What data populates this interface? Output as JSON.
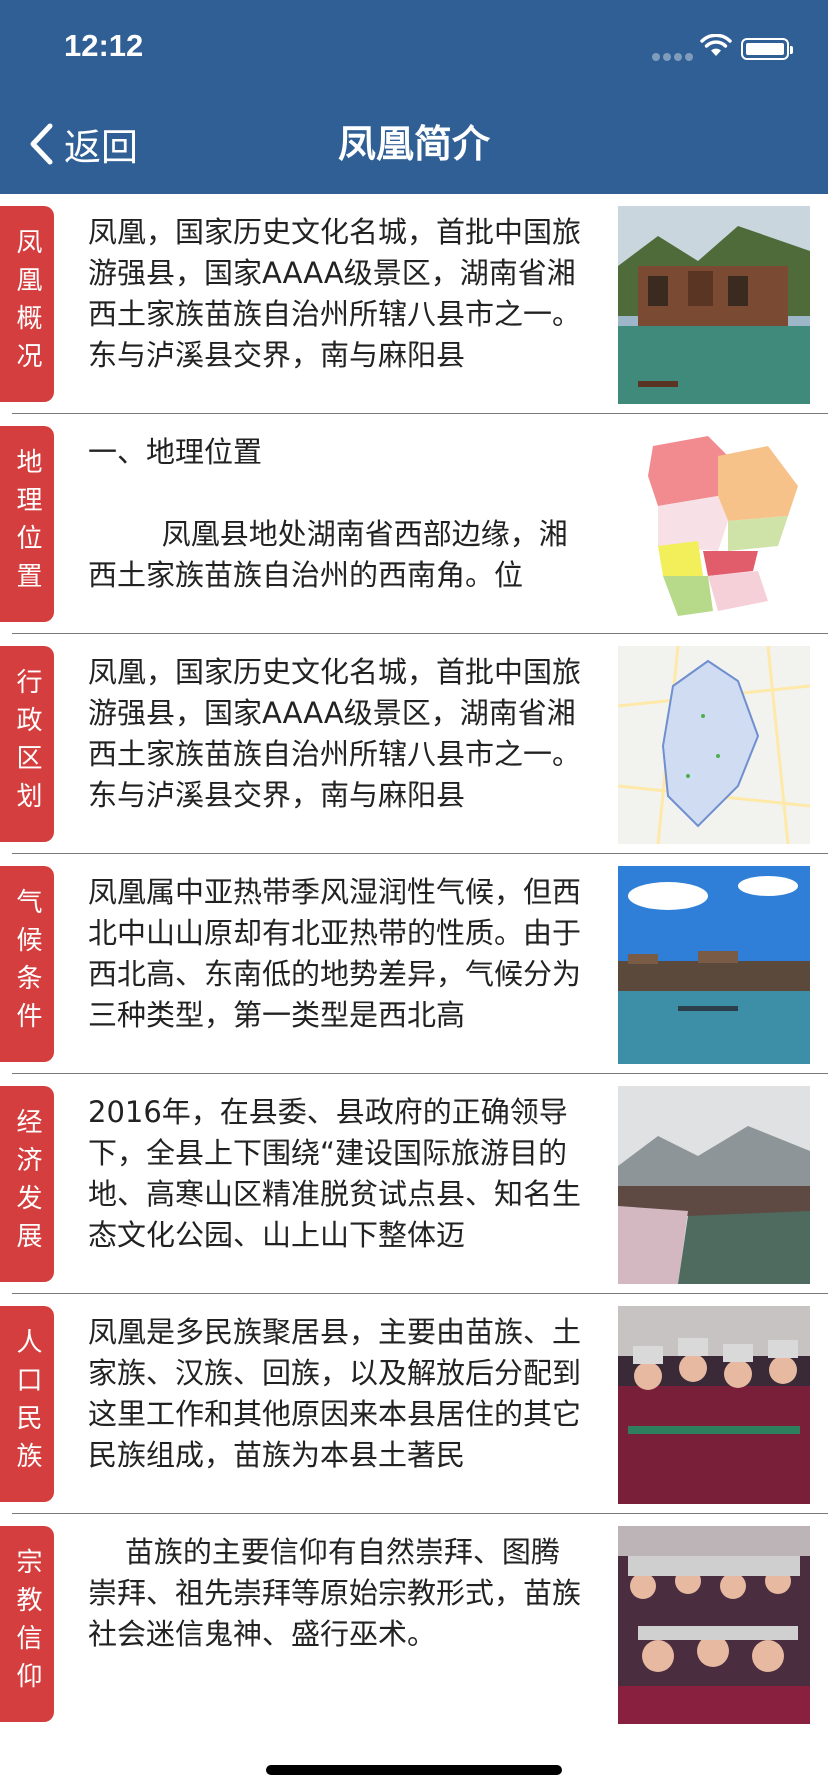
{
  "status": {
    "time": "12:12"
  },
  "nav": {
    "back_label": "返回",
    "title": "凤凰简介"
  },
  "items": [
    {
      "tag": "凤凰概况",
      "text": "凤凰，国家历史文化名城，首批中国旅游强县，国家AAAA级景区，湖南省湘西土家族苗族自治州所辖八县市之一。东与泸溪县交界，南与麻阳县"
    },
    {
      "tag": "地理位置",
      "text": "一、地理位置\n\n        凤凰县地处湖南省西部边缘，湘西土家族苗族自治州的西南角。位"
    },
    {
      "tag": "行政区划",
      "text": "凤凰，国家历史文化名城，首批中国旅游强县，国家AAAA级景区，湖南省湘西土家族苗族自治州所辖八县市之一。东与泸溪县交界，南与麻阳县"
    },
    {
      "tag": "气候条件",
      "text": "凤凰属中亚热带季风湿润性气候，但西北中山山原却有北亚热带的性质。由于西北高、东南低的地势差异，气候分为三种类型，第一类型是西北高"
    },
    {
      "tag": "经济发展",
      "text": "2016年，在县委、县政府的正确领导下，全县上下围绕“建设国际旅游目的地、高寒山区精准脱贫试点县、知名生态文化公园、山上山下整体迈"
    },
    {
      "tag": "人口民族",
      "text": "凤凰是多民族聚居县，主要由苗族、土家族、汉族、回族，以及解放后分配到这里工作和其他原因来本县居住的其它民族组成，苗族为本县土著民"
    },
    {
      "tag": "宗教信仰",
      "text": "    苗族的主要信仰有自然崇拜、图腾崇拜、祖先崇拜等原始宗教形式，苗族社会迷信鬼神、盛行巫术。"
    }
  ],
  "colors": {
    "nav": "#2f5f94",
    "tag": "#d53e3e"
  }
}
